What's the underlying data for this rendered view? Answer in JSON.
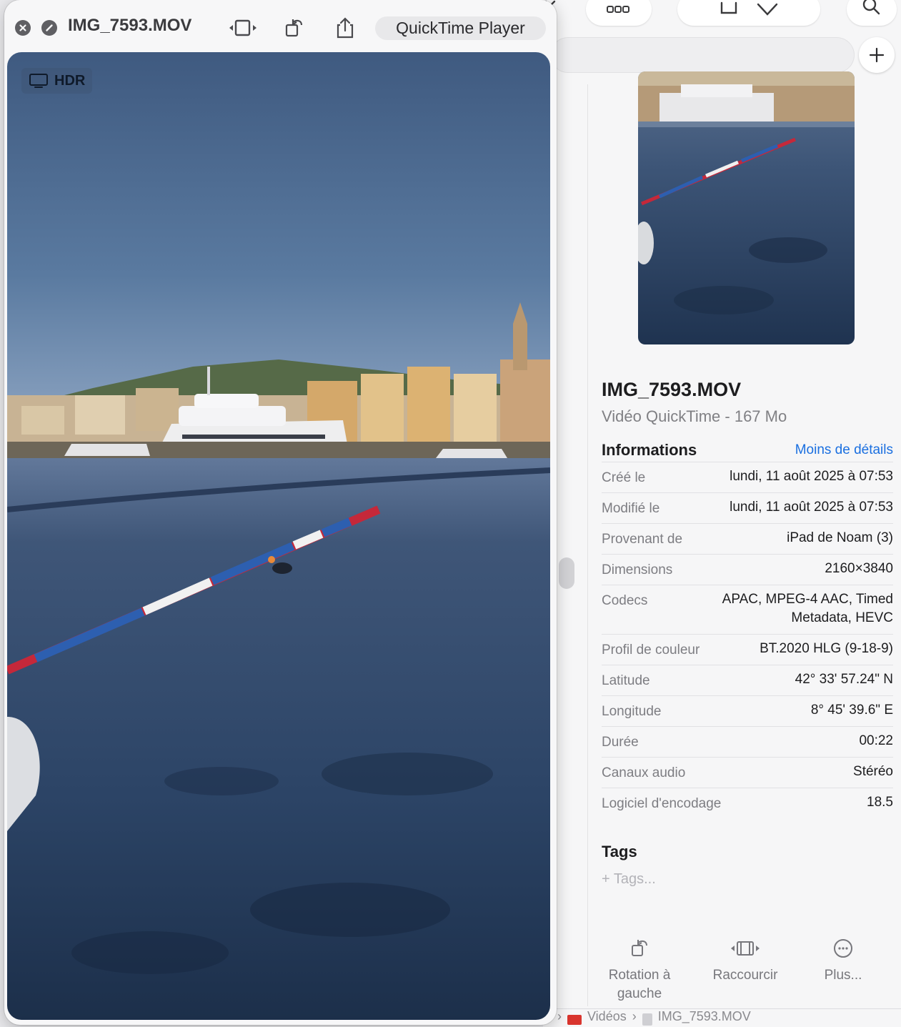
{
  "quicktime": {
    "filename": "IMG_7593.MOV",
    "app_name": "QuickTime Player",
    "hdr_badge": "HDR",
    "toolbar_icons": [
      "close-icon",
      "minimize-icon",
      "trim-icon",
      "rotate-icon",
      "share-icon"
    ]
  },
  "finder": {
    "file_name": "IMG_7593.MOV",
    "file_kind": "Vidéo QuickTime - 167 Mo",
    "info_title": "Informations",
    "less_details": "Moins de détails",
    "rows": [
      {
        "key": "Créé le",
        "value": "lundi, 11 août 2025 à 07:53"
      },
      {
        "key": "Modifié le",
        "value": "lundi, 11 août 2025 à 07:53"
      },
      {
        "key": "Provenant de",
        "value": "iPad de Noam (3)"
      },
      {
        "key": "Dimensions",
        "value": "2160×3840"
      },
      {
        "key": "Codecs",
        "value": "APAC, MPEG-4 AAC, Timed",
        "value2": "Metadata, HEVC"
      },
      {
        "key": "Profil de couleur",
        "value": "BT.2020 HLG (9-18-9)"
      },
      {
        "key": "Latitude",
        "value": "42° 33' 57.24\" N"
      },
      {
        "key": "Longitude",
        "value": "8° 45' 39.6\" E"
      },
      {
        "key": "Durée",
        "value": "00:22"
      },
      {
        "key": "Canaux audio",
        "value": "Stéréo"
      },
      {
        "key": "Logiciel d'encodage",
        "value": "18.5"
      }
    ],
    "tags_title": "Tags",
    "tags_placeholder": "+ Tags...",
    "actions": [
      {
        "label": "Rotation à",
        "label2": "gauche"
      },
      {
        "label": "Raccourcir"
      },
      {
        "label": "Plus..."
      }
    ],
    "pathbar": {
      "folder": "Vidéos",
      "sep": "›",
      "file": "IMG_7593.MOV"
    }
  },
  "colors": {
    "accent_link": "#1a6fe0",
    "sky_top": "#3f5a80",
    "sea": "#2c4466"
  }
}
